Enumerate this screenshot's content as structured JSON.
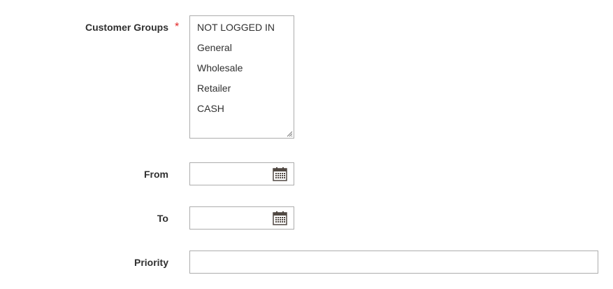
{
  "customer_groups": {
    "label": "Customer Groups",
    "required_marker": "*",
    "options": [
      "NOT LOGGED IN",
      "General",
      "Wholesale",
      "Retailer",
      "CASH"
    ]
  },
  "from": {
    "label": "From",
    "value": "",
    "icon": "calendar-icon"
  },
  "to": {
    "label": "To",
    "value": "",
    "icon": "calendar-icon"
  },
  "priority": {
    "label": "Priority",
    "value": ""
  },
  "colors": {
    "required": "#e22626",
    "border": "#adadad",
    "label_text": "#303030"
  }
}
